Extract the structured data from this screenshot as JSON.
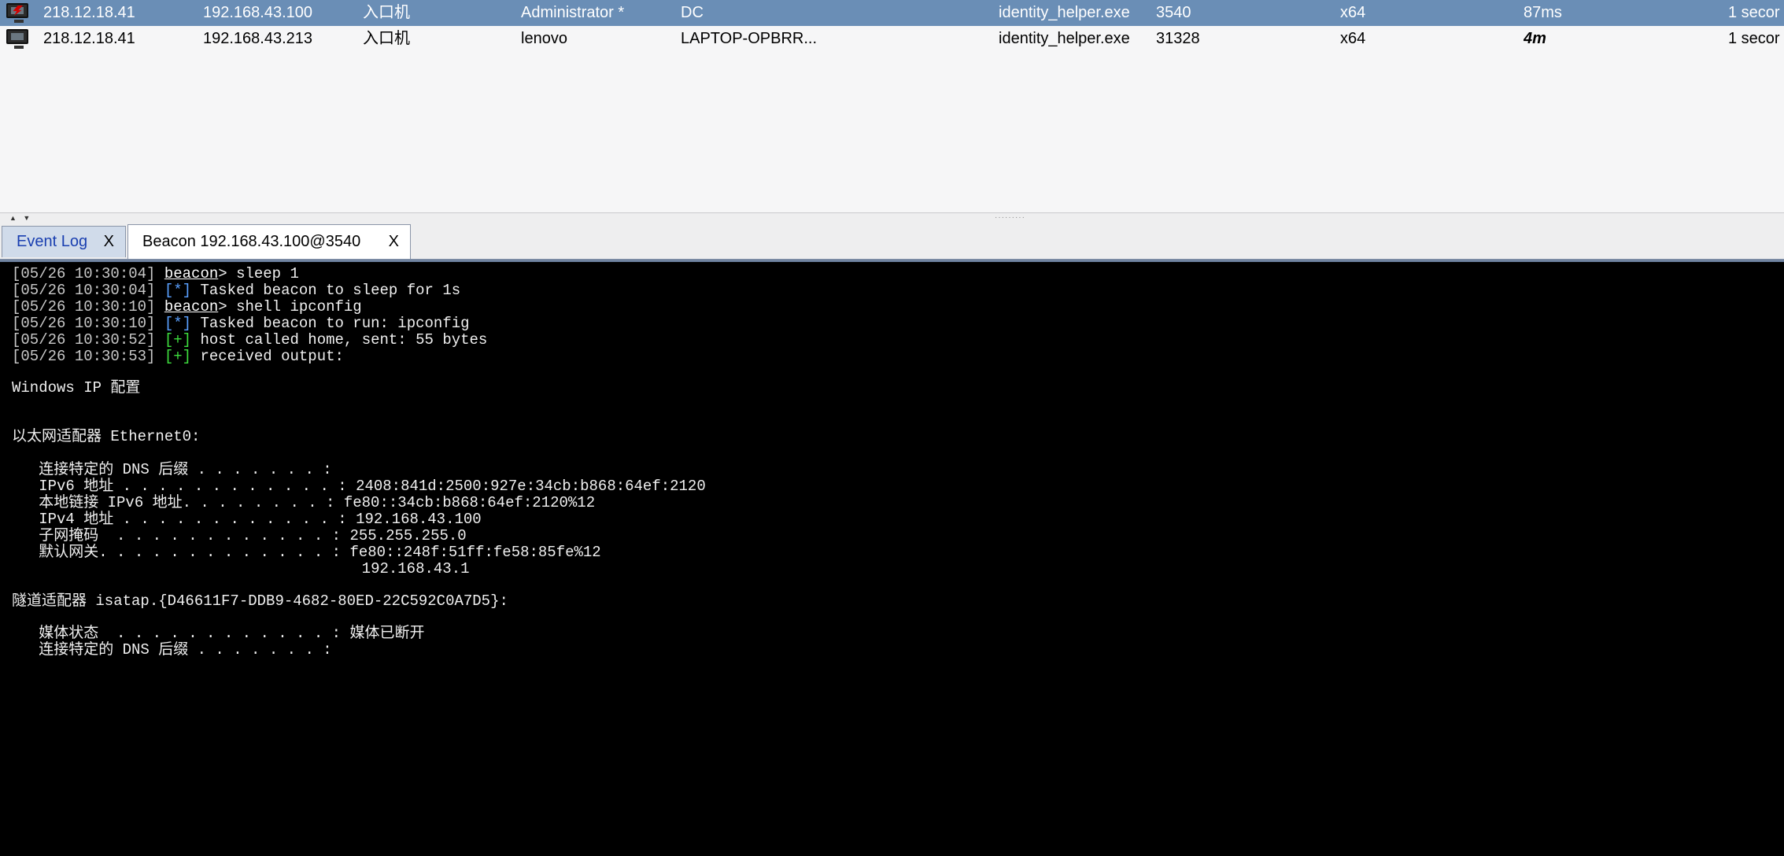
{
  "sessions": {
    "rows": [
      {
        "external": "218.12.18.41",
        "internal": "192.168.43.100",
        "listener": "入口机",
        "user": "Administrator *",
        "computer": "DC",
        "process": "identity_helper.exe",
        "pid": "3540",
        "arch": "x64",
        "last": "87ms",
        "sleep": "1 secor",
        "selected": true,
        "icon": "beacon-elevated-monitor-icon"
      },
      {
        "external": "218.12.18.41",
        "internal": "192.168.43.213",
        "listener": "入口机",
        "user": "lenovo",
        "computer": "LAPTOP-OPBRR...",
        "process": "identity_helper.exe",
        "pid": "31328",
        "arch": "x64",
        "last": "4m",
        "sleep": "1 secor",
        "selected": false,
        "icon": "beacon-monitor-icon"
      }
    ]
  },
  "tabs": [
    {
      "label": "Event Log",
      "close": "X",
      "active": false
    },
    {
      "label": "Beacon 192.168.43.100@3540",
      "close": "X",
      "active": true
    }
  ],
  "console": {
    "log": [
      {
        "ts": "[05/26 10:30:04]",
        "prompt": "beacon",
        "text": "> sleep 1"
      },
      {
        "ts": "[05/26 10:30:04]",
        "marker": "[*]",
        "text": " Tasked beacon to sleep for 1s"
      },
      {
        "ts": "[05/26 10:30:10]",
        "prompt": "beacon",
        "text": "> shell ipconfig"
      },
      {
        "ts": "[05/26 10:30:10]",
        "marker": "[*]",
        "text": " Tasked beacon to run: ipconfig"
      },
      {
        "ts": "[05/26 10:30:52]",
        "marker": "[+]",
        "text": " host called home, sent: 55 bytes"
      },
      {
        "ts": "[05/26 10:30:53]",
        "marker": "[+]",
        "text": " received output:"
      }
    ],
    "output": [
      "Windows IP 配置",
      "以太网适配器 Ethernet0:",
      "   连接特定的 DNS 后缀 . . . . . . . :",
      "   IPv6 地址 . . . . . . . . . . . . : 2408:841d:2500:927e:34cb:b868:64ef:2120",
      "   本地链接 IPv6 地址. . . . . . . . : fe80::34cb:b868:64ef:2120%12",
      "   IPv4 地址 . . . . . . . . . . . . : 192.168.43.100",
      "   子网掩码  . . . . . . . . . . . . : 255.255.255.0",
      "   默认网关. . . . . . . . . . . . . : fe80::248f:51ff:fe58:85fe%12",
      "                                       192.168.43.1",
      "隧道适配器 isatap.{D46611F7-DDB9-4682-80ED-22C592C0A7D5}:",
      "   媒体状态  . . . . . . . . . . . . : 媒体已断开",
      "   连接特定的 DNS 后缀 . . . . . . . :"
    ]
  }
}
